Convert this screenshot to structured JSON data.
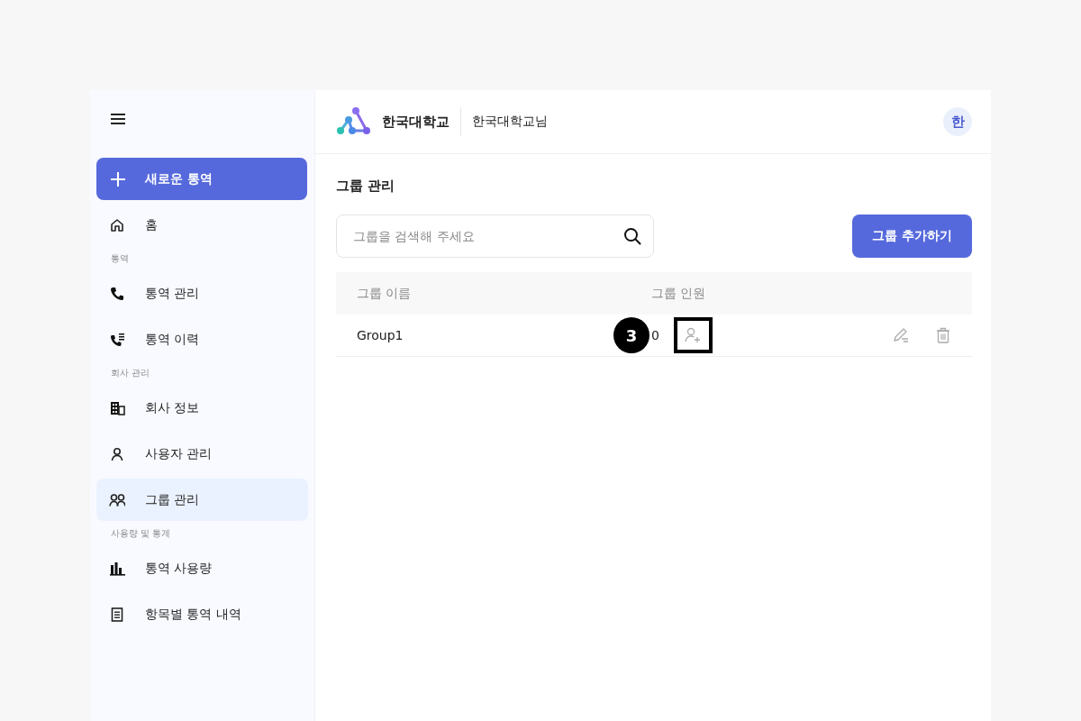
{
  "sidebar": {
    "new_button": {
      "label": "새로운 통역"
    },
    "items": [
      {
        "kind": "item",
        "label": "홈",
        "selected": false
      },
      {
        "kind": "section",
        "label": "통역"
      },
      {
        "kind": "item",
        "label": "통역 관리",
        "selected": false
      },
      {
        "kind": "item",
        "label": "통역 이력",
        "selected": false
      },
      {
        "kind": "section",
        "label": "회사 관리"
      },
      {
        "kind": "item",
        "label": "회사 정보",
        "selected": false
      },
      {
        "kind": "item",
        "label": "사용자 관리",
        "selected": false
      },
      {
        "kind": "item",
        "label": "그룹 관리",
        "selected": true
      },
      {
        "kind": "section",
        "label": "사용량 및 통계"
      },
      {
        "kind": "item",
        "label": "통역 사용량",
        "selected": false
      },
      {
        "kind": "item",
        "label": "항목별 통역 내역",
        "selected": false
      }
    ]
  },
  "header": {
    "org_name": "한국대학교",
    "user_name": "한국대학교님",
    "avatar": "한"
  },
  "page_title": "그룹 관리",
  "search": {
    "placeholder": "그룹을 검색해 주세요"
  },
  "add_button": "그룹 추가하기",
  "table": {
    "columns": [
      "그룹 이름",
      "그룹 인원"
    ],
    "rows": [
      {
        "name": "Group1",
        "members": "0"
      }
    ]
  },
  "callout": {
    "number": "3"
  }
}
